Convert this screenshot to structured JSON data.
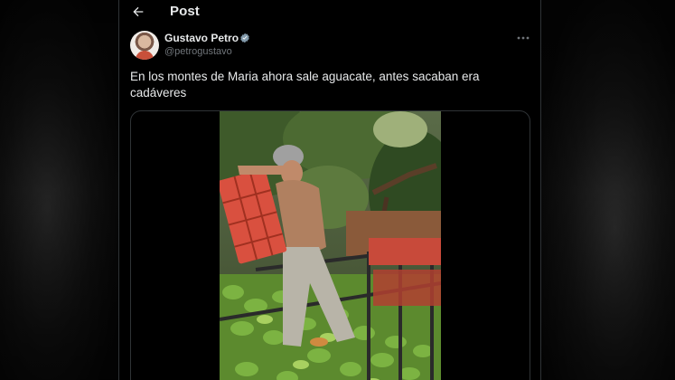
{
  "header": {
    "title": "Post",
    "back_icon": "arrow-left-icon"
  },
  "tweet": {
    "author": {
      "name": "Gustavo Petro",
      "handle": "@petrogustavo",
      "verified": true,
      "verified_color": "#829aab"
    },
    "text_line_1": "En los montes de Maria ahora sale aguacate, antes sacaban era",
    "text_line_2": "cadáveres",
    "more_icon": "more-horizontal-icon",
    "media": {
      "type": "video",
      "content": "worker-unloading-avocado-crate-icon"
    }
  },
  "colors": {
    "background": "#000000",
    "text_primary": "#e7e9ea",
    "text_secondary": "#71767b",
    "border": "#2f3336"
  }
}
